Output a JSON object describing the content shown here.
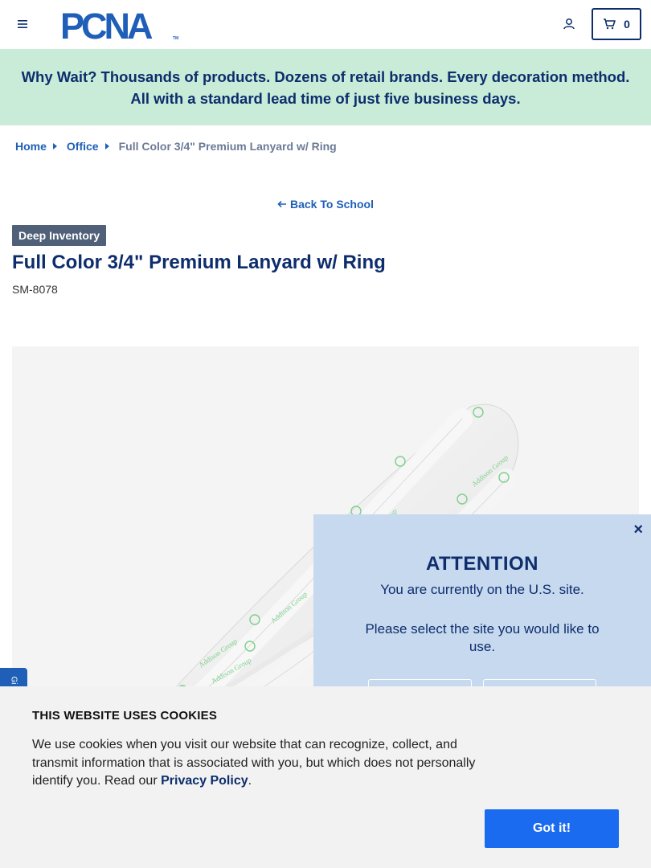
{
  "header": {
    "logo_text": "PCNA",
    "logo_tm": "TM",
    "cart_count": "0"
  },
  "promo": {
    "text": "Why Wait? Thousands of products. Dozens of retail brands. Every decoration method. All with a standard lead time of just five business days."
  },
  "breadcrumb": {
    "items": [
      "Home",
      "Office"
    ],
    "current": "Full Color 3/4\" Premium Lanyard w/ Ring"
  },
  "back_link": {
    "label": "Back To School"
  },
  "product": {
    "badge": "Deep Inventory",
    "title": "Full Color 3/4\" Premium Lanyard w/ Ring",
    "sku": "SM-8078",
    "imprint_text": "Addison Group"
  },
  "feedback_tab": {
    "label": "Gi"
  },
  "attention": {
    "close": "×",
    "title": "ATTENTION",
    "message": "You are currently on the U.S. site.",
    "prompt": "Please select the site you would like to use."
  },
  "cookie": {
    "title": "THIS WEBSITE USES COOKIES",
    "body": "We use cookies when you visit our website that can recognize, collect, and transmit information that is associated with you, but which does not personally identify you. Read our ",
    "privacy_link": "Privacy Policy",
    "suffix": ".",
    "button": "Got it!"
  },
  "colors": {
    "brand_navy": "#0d2d6c",
    "link_blue": "#1f5fb8",
    "promo_bg": "#c8ecd8",
    "attention_bg": "#c7d9ef",
    "cookie_button": "#1a6bf0",
    "badge_bg": "#4f6078"
  }
}
